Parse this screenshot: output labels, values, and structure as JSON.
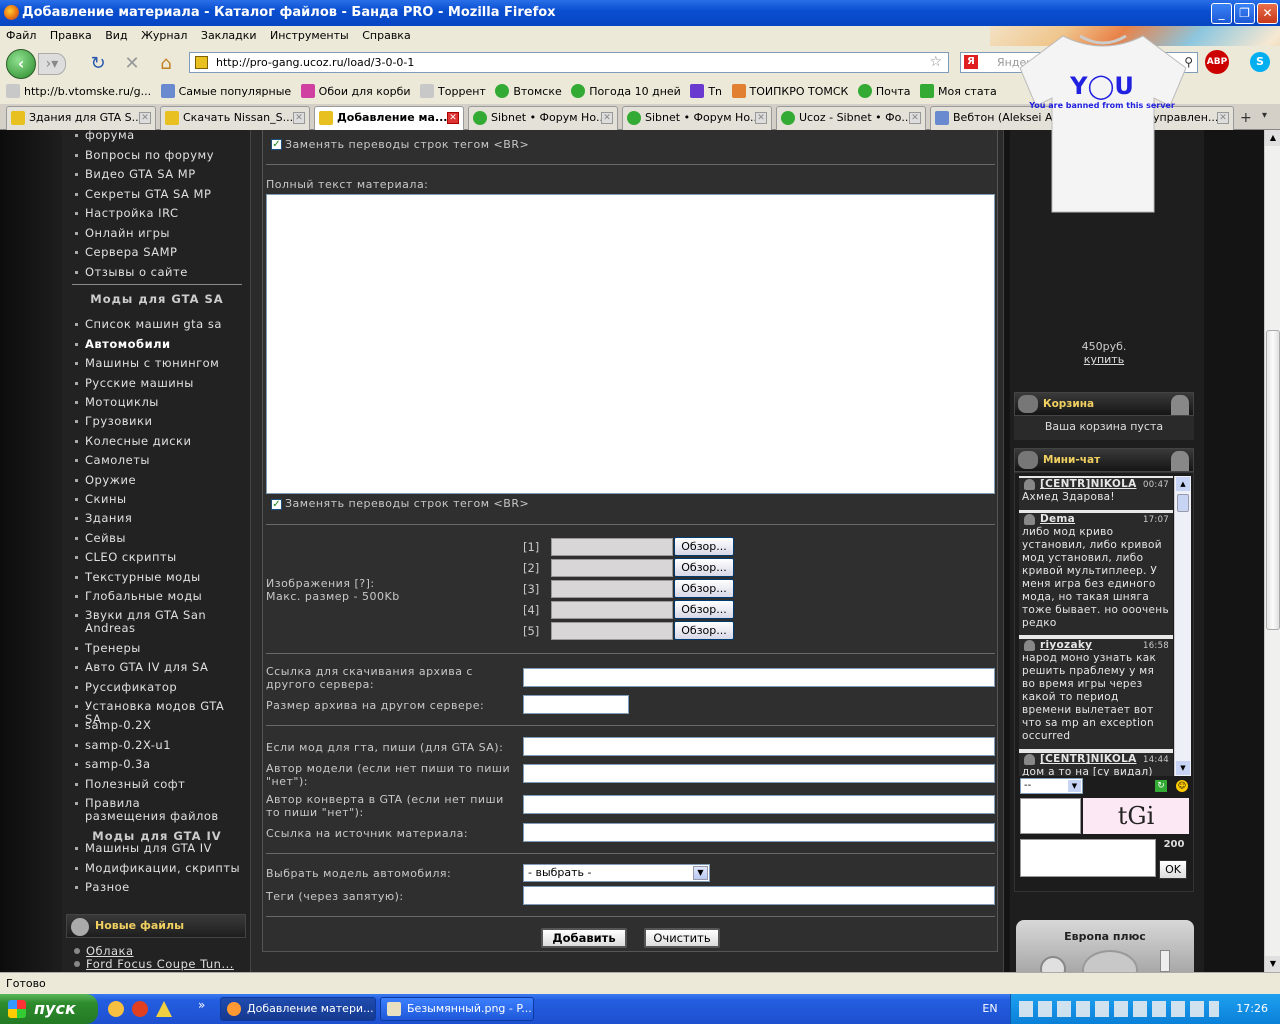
{
  "window": {
    "title": "Добавление материала - Каталог файлов - Банда PRO - Mozilla Firefox"
  },
  "menu": [
    "Файл",
    "Правка",
    "Вид",
    "Журнал",
    "Закладки",
    "Инструменты",
    "Справка"
  ],
  "nav": {
    "url": "http://pro-gang.ucoz.ru/load/3-0-0-1",
    "search_placeholder": "Яндекс"
  },
  "bookmarks": [
    "http://b.vtomske.ru/g...",
    "Самые популярные",
    "Обои для корби",
    "Торрент",
    "Втомске",
    "Погода 10 дней",
    "Tn",
    "ТОИПКРО ТОМСК",
    "Почта",
    "Моя стата"
  ],
  "tabs": [
    "Здания для GTA S...",
    "Скачать Nissan_S...",
    "Добавление ма...",
    "Sibnet • Форум Но...",
    "Sibnet • Форум Но...",
    "Ucoz - Sibnet • Фо...",
    "Вебтон (Aleksei Al...",
    "Панель управлен..."
  ],
  "sidebar": {
    "top_items": [
      "форума",
      "Вопросы по форуму",
      "Видео GTA SA MP",
      "Секреты GTA SA MP",
      "Настройка IRC",
      "Онлайн игры",
      "Сервера SAMP",
      "Отзывы о сайте"
    ],
    "section1": "Моды для GTA SA",
    "items1": [
      "Список машин gta sa",
      "Автомобили",
      "Машины с тюнингом",
      "Русские машины",
      "Мотоциклы",
      "Грузовики",
      "Колесные диски",
      "Самолеты",
      "Оружие",
      "Скины",
      "Здания",
      "Сейвы",
      "CLEO скрипты",
      "Текстурные моды",
      "Глобальные моды",
      "Звуки для GTA San Andreas",
      "Тренеры",
      "Авто GTA IV для SA",
      "Руссификатор",
      "Установка модов GTA SA",
      "samp-0.2X",
      "samp-0.2X-u1",
      "samp-0.3a",
      "Полезный софт",
      "Правила размещения файлов"
    ],
    "section2": "Моды для GTA IV",
    "items2": [
      "Машины для GTA IV",
      "Модификации, скрипты",
      "Разное"
    ],
    "newfiles_title": "Новые файлы",
    "newfiles": [
      "Облака",
      "Ford Focus Coupe Tun..."
    ]
  },
  "form": {
    "br_label": "Заменять переводы строк тегом <BR>",
    "fulltext_label": "Полный текст материала:",
    "images_label": "Изображения [?]:",
    "images_max": "Макс. размер - 500Kb",
    "slots": [
      "[1]",
      "[2]",
      "[3]",
      "[4]",
      "[5]"
    ],
    "browse": "Обзор...",
    "link_label": "Ссылка для скачивания архива с другого сервера:",
    "size_label": "Размер архива на другом сервере:",
    "mod_label": "Если мод для гта, пиши (для GTA SA):",
    "author_label": "Автор модели (если нет пиши то пиши \"нет\"):",
    "convert_label": "Автор конверта в GTA (если нет пиши то пиши \"нет\"):",
    "source_label": "Ссылка на источник материала:",
    "model_label": "Выбрать модель автомобиля:",
    "model_value": "- выбрать -",
    "tags_label": "Теги (через запятую):",
    "submit": "Добавить",
    "reset": "Очистить"
  },
  "right": {
    "buy_top": "купить",
    "shirt_text": "You are banned from this server",
    "price": "450руб.",
    "buy": "купить",
    "cart_title": "Корзина",
    "cart_empty": "Ваша корзина пуста",
    "chat_title": "Мини-чат",
    "messages": [
      {
        "who": "[CENTR]NIKOLA",
        "time": "00:47",
        "text": "Ахмед Здарова!"
      },
      {
        "who": "Dema",
        "time": "17:07",
        "text": "либо мод криво установил, либо кривой мод установил, либо кривой мультиплеер. У меня игра без единого мода, но такая шняга тоже бывает. но ооочень редко"
      },
      {
        "who": "riyozaky",
        "time": "16:58",
        "text": "народ моно узнать как решить праблему у мя во время игры через какой то период времени вылетает вот что sa mp an exception occurred"
      },
      {
        "who": "[CENTR]NIKOLA",
        "time": "14:44",
        "text": "дом а то на [су видал)"
      }
    ],
    "chat_select": "--",
    "captcha": "tGi",
    "chat_count": "200",
    "ok": "OK",
    "europa": "Европа плюс"
  },
  "status": "Готово",
  "taskbar": {
    "start": "пуск",
    "tasks": [
      "Добавление матери...",
      "Безымянный.png - P..."
    ],
    "lang": "EN",
    "clock": "17:26"
  }
}
